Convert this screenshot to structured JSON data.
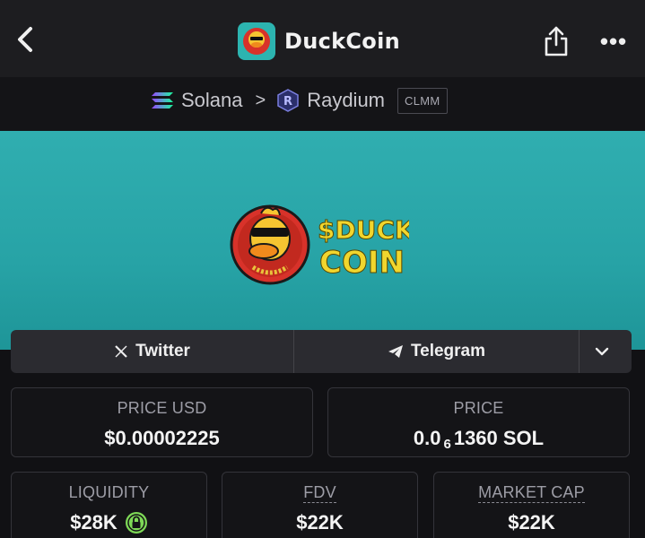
{
  "header": {
    "title": "DuckCoin",
    "back_icon": "chevron-left-icon",
    "share_icon": "share-icon",
    "more_label": "•••"
  },
  "chain": {
    "network": "Solana",
    "separator": ">",
    "dex": "Raydium",
    "pool_type": "CLMM"
  },
  "banner": {
    "logo_text_line1": "$DUCK",
    "logo_text_line2": "COIN"
  },
  "links": {
    "twitter": "Twitter",
    "telegram": "Telegram",
    "expand_icon": "chevron-down-icon"
  },
  "stats": {
    "price_usd": {
      "label": "PRICE USD",
      "value": "$0.00002225"
    },
    "price_sol": {
      "label": "PRICE",
      "value_prefix": "0.0",
      "value_sub": "6",
      "value_suffix": "1360 SOL"
    },
    "liquidity": {
      "label": "LIQUIDITY",
      "value": "$28K"
    },
    "fdv": {
      "label": "FDV",
      "value": "$22K"
    },
    "market_cap": {
      "label": "MARKET CAP",
      "value": "$22K"
    }
  },
  "colors": {
    "banner": "#2aa9ab",
    "lock_green": "#7ed957",
    "background": "#111114"
  }
}
